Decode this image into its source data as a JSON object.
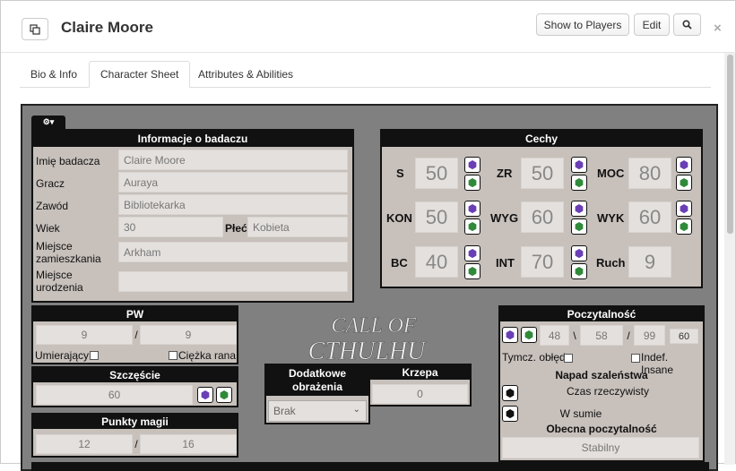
{
  "header": {
    "title": "Claire Moore",
    "show_players": "Show to Players",
    "edit": "Edit",
    "close": "×"
  },
  "tabs": [
    {
      "label": "Bio & Info"
    },
    {
      "label": "Character Sheet"
    },
    {
      "label": "Attributes & Abilities"
    }
  ],
  "info": {
    "title": "Informacje o badaczu",
    "name_label": "Imię badacza",
    "name_value": "Claire Moore",
    "player_label": "Gracz",
    "player_value": "Auraya",
    "occupation_label": "Zawód",
    "occupation_value": "Bibliotekarka",
    "age_label": "Wiek",
    "age_value": "30",
    "sex_label": "Płeć",
    "sex_value": "Kobieta",
    "residence_label": "Miejsce zamieszkania",
    "residence_value": "Arkham",
    "birthplace_label": "Miejsce urodzenia",
    "birthplace_value": ""
  },
  "traits": {
    "title": "Cechy",
    "stats": [
      {
        "label": "S",
        "value": "50"
      },
      {
        "label": "ZR",
        "value": "50"
      },
      {
        "label": "MOC",
        "value": "80"
      },
      {
        "label": "KON",
        "value": "50"
      },
      {
        "label": "WYG",
        "value": "60"
      },
      {
        "label": "WYK",
        "value": "60"
      },
      {
        "label": "BC",
        "value": "40"
      },
      {
        "label": "INT",
        "value": "70"
      },
      {
        "label": "Ruch",
        "value": "9"
      }
    ]
  },
  "hp": {
    "title": "PW",
    "current": "9",
    "sep": "/",
    "max": "9",
    "dying": "Umierający",
    "major_wound": "Ciężka rana"
  },
  "luck": {
    "title": "Szczęście",
    "value": "60"
  },
  "mp": {
    "title": "Punkty magii",
    "current": "12",
    "sep": "/",
    "max": "16"
  },
  "damage_bonus": {
    "title": "Dodatkowe obrażenia",
    "value": "Brak"
  },
  "build": {
    "title": "Krzepa",
    "value": "0"
  },
  "sanity": {
    "title": "Poczytalność",
    "current": "48",
    "sep1": "\\",
    "start": "58",
    "sep2": "/",
    "max": "99",
    "limit": "60",
    "temp_insane": "Tymcz. obłęd",
    "indef_insane": "Indef. Insane",
    "bout_title": "Napad szaleństwa",
    "realtime": "Czas rzeczywisty",
    "summary": "W sumie",
    "current_title": "Obecna poczytalność",
    "status": "Stabilny"
  },
  "logo": {
    "line1": "CALL OF",
    "line2": "CTHULHU"
  },
  "icons": {
    "popout": "popout-icon",
    "search": "search-icon",
    "settings": "gear-icon",
    "dice": "d10-dice-icon"
  },
  "colors": {
    "sheet_bg": "#808080",
    "panel_bg": "#c7c0bb",
    "title_bar": "#111111",
    "die_purple": "#6a3fb5",
    "die_green": "#2f8a3a"
  }
}
